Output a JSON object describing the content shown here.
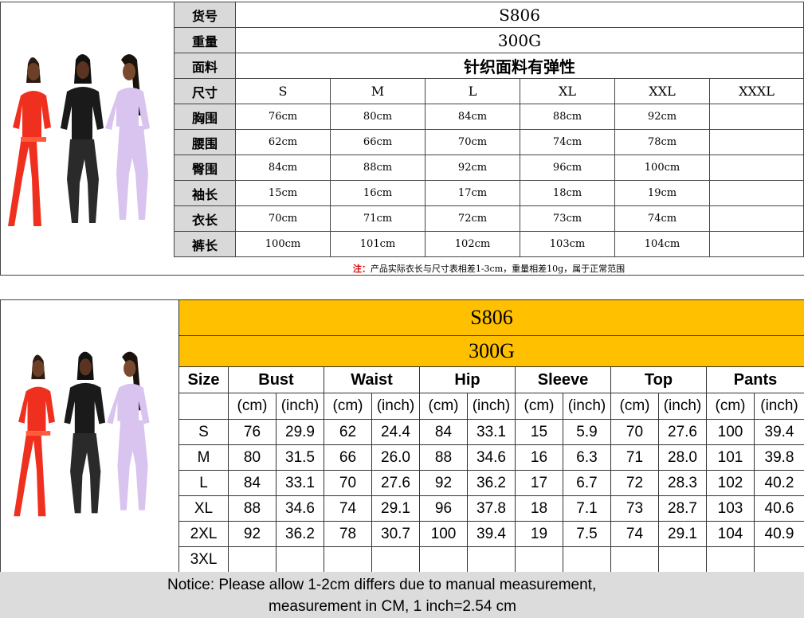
{
  "cn_chart": {
    "label_code": "货号",
    "value_code": "S806",
    "label_weight": "重量",
    "value_weight": "300G",
    "label_fabric": "面料",
    "value_fabric": "针织面料有弹性",
    "label_size": "尺寸",
    "sizes": [
      "S",
      "M",
      "L",
      "XL",
      "XXL",
      "XXXL"
    ],
    "rows": [
      {
        "label": "胸围",
        "values": [
          "76cm",
          "80cm",
          "84cm",
          "88cm",
          "92cm",
          ""
        ]
      },
      {
        "label": "腰围",
        "values": [
          "62cm",
          "66cm",
          "70cm",
          "74cm",
          "78cm",
          ""
        ]
      },
      {
        "label": "臀围",
        "values": [
          "84cm",
          "88cm",
          "92cm",
          "96cm",
          "100cm",
          ""
        ]
      },
      {
        "label": "袖长",
        "values": [
          "15cm",
          "16cm",
          "17cm",
          "18cm",
          "19cm",
          ""
        ]
      },
      {
        "label": "衣长",
        "values": [
          "70cm",
          "71cm",
          "72cm",
          "73cm",
          "74cm",
          ""
        ]
      },
      {
        "label": "裤长",
        "values": [
          "100cm",
          "101cm",
          "102cm",
          "103cm",
          "104cm",
          ""
        ]
      }
    ],
    "note_mark": "注：",
    "note_text": "产品实际衣长与尺寸表相差1-3cm，重量相差10g，属于正常范围"
  },
  "en_chart": {
    "code": "S806",
    "weight": "300G",
    "size_header": "Size",
    "measures": [
      "Bust",
      "Waist",
      "Hip",
      "Sleeve",
      "Top",
      "Pants"
    ],
    "unit_cm": "(cm)",
    "unit_inch": "(inch)",
    "rows": [
      {
        "size": "S",
        "values": [
          "76",
          "29.9",
          "62",
          "24.4",
          "84",
          "33.1",
          "15",
          "5.9",
          "70",
          "27.6",
          "100",
          "39.4"
        ]
      },
      {
        "size": "M",
        "values": [
          "80",
          "31.5",
          "66",
          "26.0",
          "88",
          "34.6",
          "16",
          "6.3",
          "71",
          "28.0",
          "101",
          "39.8"
        ]
      },
      {
        "size": "L",
        "values": [
          "84",
          "33.1",
          "70",
          "27.6",
          "92",
          "36.2",
          "17",
          "6.7",
          "72",
          "28.3",
          "102",
          "40.2"
        ]
      },
      {
        "size": "XL",
        "values": [
          "88",
          "34.6",
          "74",
          "29.1",
          "96",
          "37.8",
          "18",
          "7.1",
          "73",
          "28.7",
          "103",
          "40.6"
        ]
      },
      {
        "size": "2XL",
        "values": [
          "92",
          "36.2",
          "78",
          "30.7",
          "100",
          "39.4",
          "19",
          "7.5",
          "74",
          "29.1",
          "104",
          "40.9"
        ]
      },
      {
        "size": "3XL",
        "values": [
          "",
          "",
          "",
          "",
          "",
          "",
          "",
          "",
          "",
          "",
          "",
          ""
        ]
      }
    ],
    "notice_line1": "Notice: Please allow 1-2cm differs due to manual measurement,",
    "notice_line2": "measurement in CM, 1 inch=2.54 cm"
  },
  "colors": {
    "banner": "#ffc000",
    "label_bg": "#d9d9d9",
    "notice_bg": "#dcdcdc",
    "note_red": "#e00000",
    "outfit_red": "#f0301e",
    "outfit_black": "#1a1a1a",
    "outfit_lilac": "#d8c4ee"
  }
}
